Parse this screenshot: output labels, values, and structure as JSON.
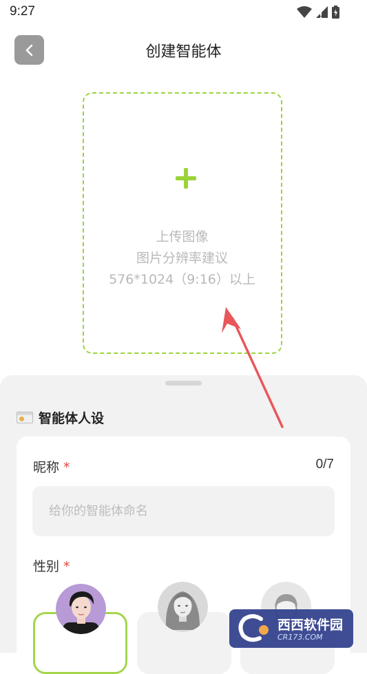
{
  "status_bar": {
    "time": "9:27",
    "icons": [
      "wifi-icon",
      "signal-icon",
      "battery-icon"
    ]
  },
  "header": {
    "title": "创建智能体",
    "back_icon": "chevron-left-icon"
  },
  "upload": {
    "icon": "plus-icon",
    "title": "上传图像",
    "hint_line1": "图片分辨率建议",
    "hint_line2": "576*1024（9:16）以上"
  },
  "persona": {
    "section_icon": "id-card-icon",
    "section_title": "智能体人设",
    "nickname": {
      "label": "昵称",
      "required_mark": "*",
      "count": "0/7",
      "placeholder": "给你的智能体命名",
      "value": ""
    },
    "gender": {
      "label": "性别",
      "required_mark": "*",
      "options": [
        "male-avatar",
        "female-avatar",
        "other-avatar"
      ],
      "selected": "male-avatar"
    }
  },
  "watermark": {
    "brand": "西西软件园",
    "url": "CR173.COM"
  },
  "colors": {
    "accent": "#9bd33a",
    "annotation_arrow": "#e8575a",
    "required": "#e0473c",
    "sheet_bg": "#f2f2f2"
  }
}
